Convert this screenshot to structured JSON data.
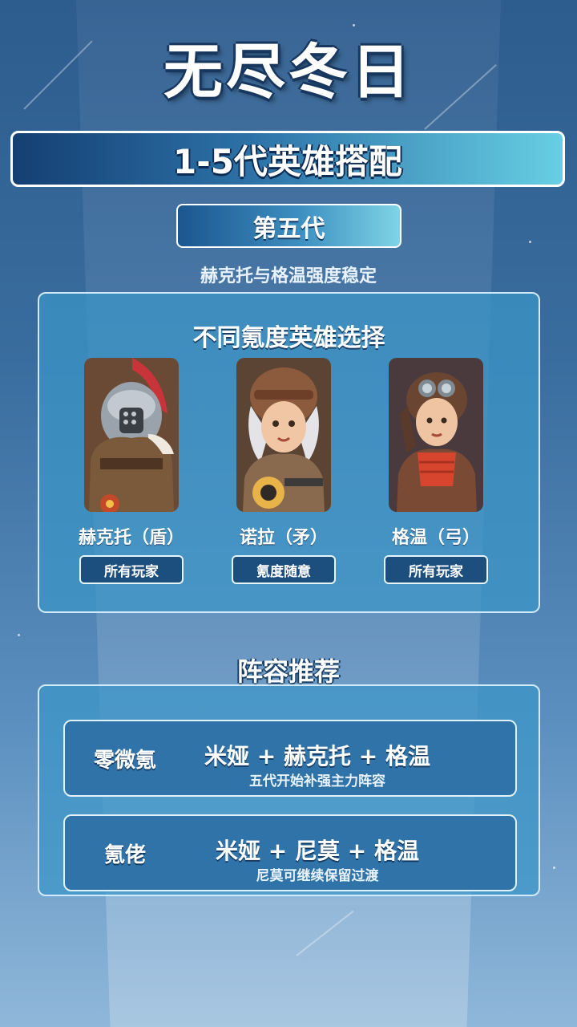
{
  "header": {
    "title": "无尽冬日"
  },
  "banner": {
    "label": "1-5代英雄搭配"
  },
  "generation": {
    "label": "第五代",
    "subtitle": "赫克托与格温强度稳定"
  },
  "hero_panel": {
    "title": "不同氪度英雄选择",
    "heroes": [
      {
        "name": "赫克托（盾）",
        "tag": "所有玩家",
        "portrait": "gladiator-helmet-portrait"
      },
      {
        "name": "诺拉（矛）",
        "tag": "氪度随意",
        "portrait": "aviator-rider-portrait"
      },
      {
        "name": "格温（弓）",
        "tag": "所有玩家",
        "portrait": "goggles-pilot-portrait"
      }
    ]
  },
  "lineup": {
    "heading": "阵容推荐",
    "rows": [
      {
        "label": "零微氪",
        "combo": "米娅 + 赫克托 + 格温",
        "note": "五代开始补强主力阵容"
      },
      {
        "label": "氪佬",
        "combo": "米娅 + 尼莫 + 格温",
        "note": "尼莫可继续保留过渡"
      }
    ]
  },
  "colors": {
    "banner_start": "#143f73",
    "banner_end": "#67cfe3",
    "panel": "#3c96c8",
    "tag_bg": "#1d4f7e"
  }
}
